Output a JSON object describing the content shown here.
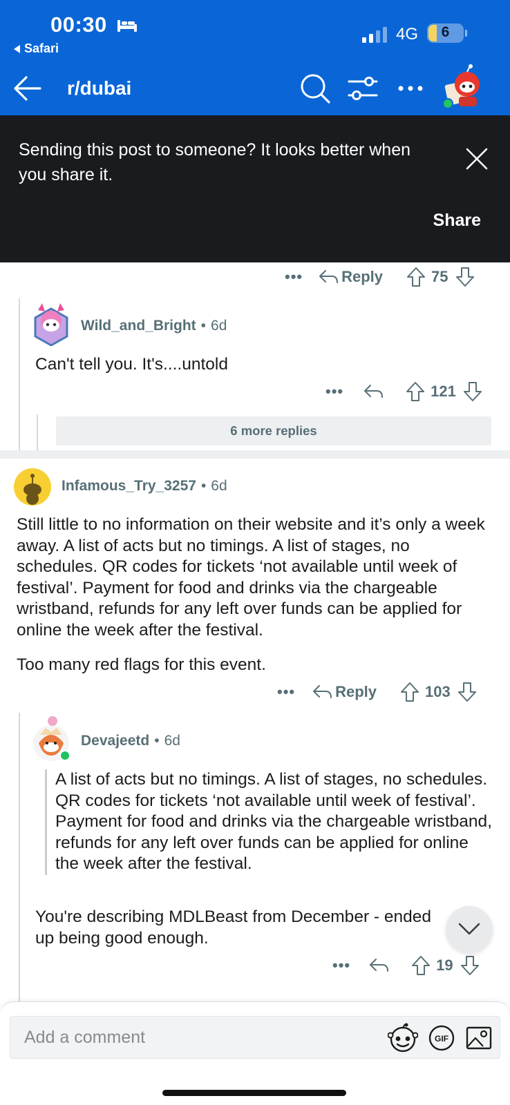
{
  "status_bar": {
    "time": "00:30",
    "back_app": "Safari",
    "network": "4G",
    "battery": "6"
  },
  "header": {
    "subreddit": "r/dubai"
  },
  "share_banner": {
    "message": "Sending this post to someone? It looks better when you share it.",
    "share_label": "Share"
  },
  "comments": {
    "prev": {
      "reply_label": "Reply",
      "score": "75"
    },
    "wild": {
      "username": "Wild_and_Bright",
      "age": "6d",
      "text": "Can't tell you. It's....untold",
      "score": "121",
      "more_replies": "6 more replies"
    },
    "infamous": {
      "username": "Infamous_Try_3257",
      "age": "6d",
      "paragraph1": "Still little to no information on their website and it’s only a week away. A list of acts but no timings. A list of stages, no schedules. QR codes for tickets ‘not available until week of festival’.  Payment for food and drinks via the chargeable wristband, refunds for any left over funds can be applied for online the week after the festival.",
      "paragraph2": "Too many red flags for this event.",
      "reply_label": "Reply",
      "score": "103"
    },
    "devajeetd": {
      "username": "Devajeetd",
      "age": "6d",
      "quote": "A list of acts but no timings. A list of stages, no schedules. QR codes for tickets ‘not available until week of festival’. Payment for food and drinks via the chargeable wristband, refunds for any left over funds can be applied for online the week after the festival.",
      "text": "You're describing MDLBeast from December - ended up being good enough.",
      "score": "19"
    }
  },
  "composer": {
    "placeholder": "Add a comment"
  },
  "colors": {
    "header_blue": "#0a66d6",
    "banner_dark": "#1a1b1e",
    "meta_gray": "#576f76",
    "online_green": "#1fc160"
  },
  "icons": [
    "bed-icon",
    "signal-icon",
    "back-arrow-icon",
    "search-icon",
    "filter-icon",
    "more-icon",
    "close-icon",
    "reply-icon",
    "upvote-icon",
    "downvote-icon",
    "chevron-down-icon",
    "snoo-icon",
    "gif-icon",
    "image-icon"
  ]
}
